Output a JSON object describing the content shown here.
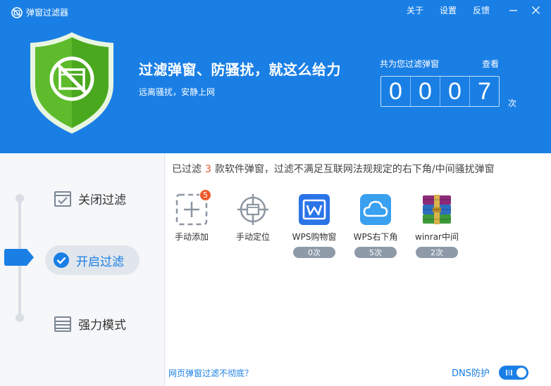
{
  "window": {
    "title": "弹窗过滤器",
    "menu": [
      "关于",
      "设置",
      "反馈"
    ]
  },
  "header": {
    "headline": "过滤弹窗、防骚扰，就这么给力",
    "subline": "远离骚扰，安静上网",
    "stats_label": "共为您过滤弹窗",
    "stats_view": "查看",
    "counter_digits": [
      "0",
      "0",
      "0",
      "7"
    ],
    "counter_unit": "次"
  },
  "sidebar": {
    "modes": [
      {
        "label": "关闭过滤",
        "icon": "checkbox-window-icon"
      },
      {
        "label": "开启过滤",
        "icon": "check-circle-icon",
        "active": true
      },
      {
        "label": "强力模式",
        "icon": "window-stack-icon"
      }
    ]
  },
  "main": {
    "summary_prefix": "已过滤",
    "summary_count": "3",
    "summary_suffix": "款软件弹窗，过滤不满足互联网法规规定的右下角/中间骚扰弹窗",
    "apps": [
      {
        "label": "手动添加",
        "icon": "manual-add-icon",
        "badge": "5"
      },
      {
        "label": "手动定位",
        "icon": "crosshair-icon"
      },
      {
        "label": "WPS购物窗",
        "icon": "wps-icon",
        "count": "0次"
      },
      {
        "label": "WPS右下角",
        "icon": "cloud-icon",
        "count": "5次"
      },
      {
        "label": "winrar中间",
        "icon": "winrar-icon",
        "count": "2次"
      }
    ],
    "bottom_link": "网页弹窗过滤不彻底？",
    "dns_label": "DNS防护",
    "dns_enabled": true
  },
  "colors": {
    "header_blue": "#1a7fe5",
    "shield_green": "#5dbb2c",
    "badge_orange": "#ef5a2c",
    "pill_gray": "#8e9aa8"
  }
}
